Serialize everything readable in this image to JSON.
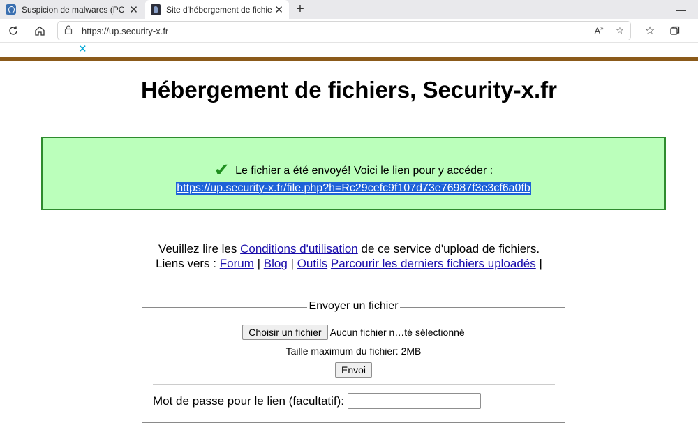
{
  "browser": {
    "tabs": [
      {
        "title": "Suspicion de malwares (PC très l",
        "active": false
      },
      {
        "title": "Site d'hébergement de fichiers, S",
        "active": true
      }
    ],
    "url": "https://up.security-x.fr",
    "icons": {
      "back": "refresh-icon",
      "home": "home-icon",
      "read_aloud": "Ă",
      "favorites_add": "star-plus-icon",
      "favorites": "favorites-icon",
      "collections": "collections-icon"
    }
  },
  "ad": {
    "close_label": "✕"
  },
  "page": {
    "title": "Hébergement de fichiers, Security-x.fr",
    "success": {
      "message": "Le fichier a été envoyé! Voici le lien pour y accéder :",
      "link": "https://up.security-x.fr/file.php?h=Rc29cefc9f107d73e76987f3e3cf6a0fb"
    },
    "info": {
      "read_prefix": "Veuillez lire les",
      "terms_link": "Conditions d'utilisation",
      "read_suffix": "de ce service d'upload de fichiers.",
      "links_prefix": "Liens vers :",
      "forum": "Forum",
      "blog": "Blog",
      "tools": "Outils",
      "latest": "Parcourir les derniers fichiers uploadés",
      "separator": "|"
    },
    "upload": {
      "legend": "Envoyer un fichier",
      "choose_button": "Choisir un fichier",
      "no_file": "Aucun fichier n…té sélectionné",
      "max_size": "Taille maximum du fichier: 2MB",
      "submit": "Envoi",
      "password_label": "Mot de passe pour le lien (facultatif):",
      "password_value": ""
    }
  },
  "colors": {
    "success_bg": "#bbffbb",
    "success_border": "#2e8b2e",
    "header_line": "#8b5a1a",
    "link": "#1a0dab",
    "selection": "#1e62d8"
  }
}
